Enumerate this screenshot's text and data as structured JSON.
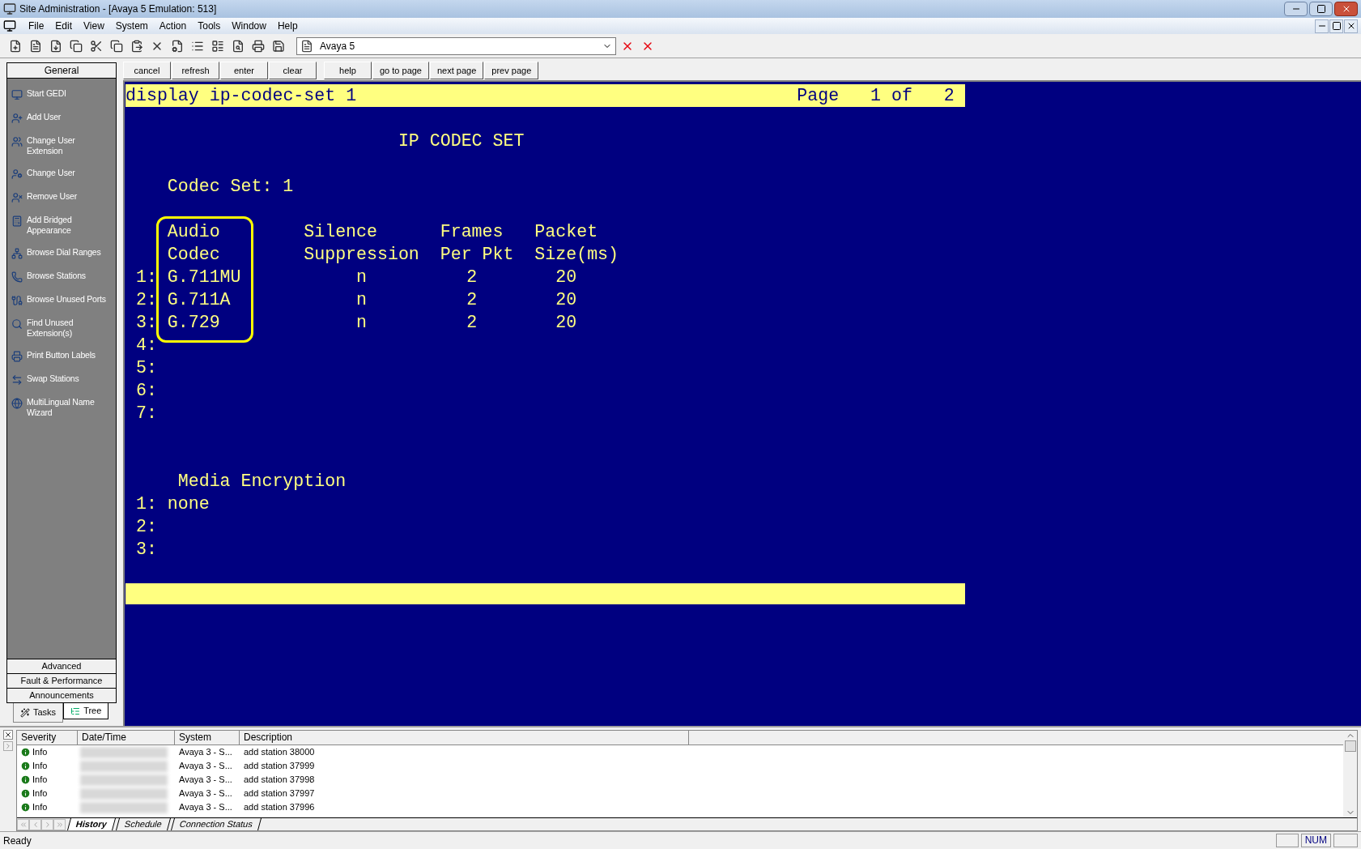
{
  "window": {
    "title": "Site Administration - [Avaya 5 Emulation: 513]"
  },
  "menu": [
    "File",
    "Edit",
    "View",
    "System",
    "Action",
    "Tools",
    "Window",
    "Help"
  ],
  "toolbar": {
    "connection": "Avaya 5"
  },
  "command_buttons": [
    "cancel",
    "refresh",
    "enter",
    "clear",
    "help",
    "go to page",
    "next page",
    "prev page"
  ],
  "sidebar": {
    "header": "General",
    "items": [
      {
        "label": "Start GEDI"
      },
      {
        "label": "Add User"
      },
      {
        "label": "Change User Extension"
      },
      {
        "label": "Change User"
      },
      {
        "label": "Remove User"
      },
      {
        "label": "Add Bridged Appearance"
      },
      {
        "label": "Browse Dial Ranges"
      },
      {
        "label": "Browse Stations"
      },
      {
        "label": "Browse Unused Ports"
      },
      {
        "label": "Find Unused Extension(s)"
      },
      {
        "label": "Print Button Labels"
      },
      {
        "label": "Swap Stations"
      },
      {
        "label": "MultiLingual Name Wizard"
      }
    ],
    "sections": [
      "Advanced",
      "Fault & Performance",
      "Announcements"
    ],
    "tabs": [
      {
        "label": "Tasks",
        "selected": true
      },
      {
        "label": "Tree",
        "selected": false
      }
    ]
  },
  "terminal": {
    "command": "display ip-codec-set 1",
    "page": "Page   1 of   2",
    "title": "IP CODEC SET",
    "codec_set": "Codec Set: 1",
    "headers": [
      [
        "Audio",
        "Codec"
      ],
      [
        "Silence",
        "Suppression"
      ],
      [
        "Frames",
        "Per Pkt"
      ],
      [
        "Packet",
        "Size(ms)"
      ]
    ],
    "rows": [
      {
        "num": "1:",
        "codec": "G.711MU",
        "silence": "n",
        "frames": "2",
        "packet": "20"
      },
      {
        "num": "2:",
        "codec": "G.711A",
        "silence": "n",
        "frames": "2",
        "packet": "20"
      },
      {
        "num": "3:",
        "codec": "G.729",
        "silence": "n",
        "frames": "2",
        "packet": "20"
      },
      {
        "num": "4:"
      },
      {
        "num": "5:"
      },
      {
        "num": "6:"
      },
      {
        "num": "7:"
      }
    ],
    "encryption_title": "Media Encryption",
    "encryption": [
      {
        "num": "1:",
        "value": "none"
      },
      {
        "num": "2:"
      },
      {
        "num": "3:"
      }
    ]
  },
  "log": {
    "columns": [
      "Severity",
      "Date/Time",
      "System",
      "Description"
    ],
    "rows": [
      {
        "severity": "Info",
        "system": "Avaya 3 - S...",
        "description": "add station 38000"
      },
      {
        "severity": "Info",
        "system": "Avaya 3 - S...",
        "description": "add station 37999"
      },
      {
        "severity": "Info",
        "system": "Avaya 3 - S...",
        "description": "add station 37998"
      },
      {
        "severity": "Info",
        "system": "Avaya 3 - S...",
        "description": "add station 37997"
      },
      {
        "severity": "Info",
        "system": "Avaya 3 - S...",
        "description": "add station 37996"
      }
    ],
    "tabs": [
      {
        "label": "History",
        "selected": true
      },
      {
        "label": "Schedule",
        "selected": false
      },
      {
        "label": "Connection Status",
        "selected": false
      }
    ]
  },
  "status_bar": {
    "text": "Ready",
    "indicators": [
      "NUM"
    ]
  }
}
